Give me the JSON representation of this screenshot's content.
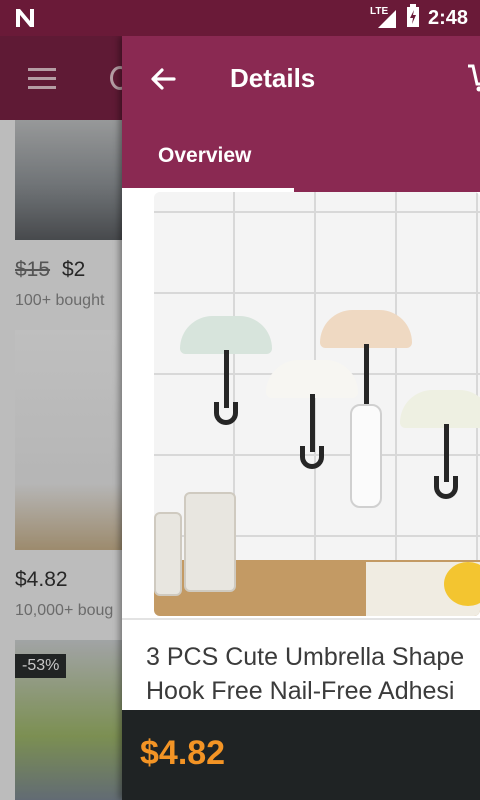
{
  "status_bar": {
    "time": "2:48",
    "network": "LTE"
  },
  "background_list": {
    "items": [
      {
        "old_price": "$15",
        "price": "$2",
        "sold": "100+ bought"
      },
      {
        "price": "$4.82",
        "sold": "10,000+ boug"
      },
      {
        "discount": "-53%"
      }
    ]
  },
  "details": {
    "title": "Details",
    "tab": "Overview",
    "product_title_line1": "3 PCS Cute Umbrella Shape",
    "product_title_line2": "Hook Free Nail-Free Adhesi",
    "price": "$4.82"
  },
  "colors": {
    "appbar": "#8a2952",
    "statusbar": "#6a1a38",
    "price_accent": "#f39425"
  },
  "icons": [
    "menu-icon",
    "search-icon",
    "back-arrow-icon",
    "cart-icon",
    "lte-signal-icon",
    "battery-charging-icon",
    "notification-n-icon"
  ]
}
